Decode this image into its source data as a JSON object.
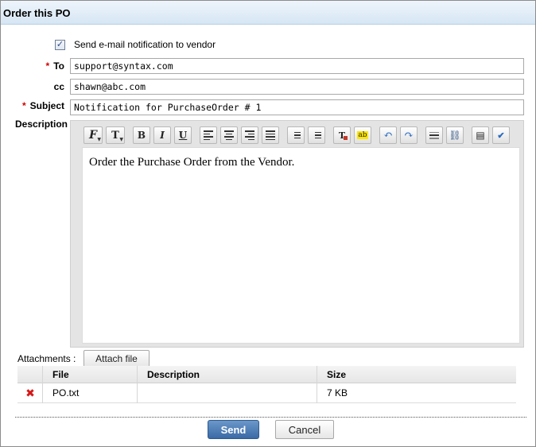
{
  "dialog": {
    "title": "Order this PO"
  },
  "notify": {
    "checked": "✓",
    "label": "Send e-mail notification to vendor"
  },
  "fields": {
    "required_mark": "*",
    "to_label": "To",
    "to_value": "support@syntax.com",
    "cc_label": "cc",
    "cc_value": "shawn@abc.com",
    "subject_label": "Subject",
    "subject_value": "Notification for PurchaseOrder # 1",
    "description_label": "Description"
  },
  "editor": {
    "toolbar": [
      "font-family-icon",
      "font-size-icon",
      "bold-icon",
      "italic-icon",
      "underline-icon",
      "align-left-icon",
      "align-center-icon",
      "align-right-icon",
      "justify-icon",
      "numbered-list-icon",
      "bullet-list-icon",
      "text-color-icon",
      "highlight-icon",
      "undo-icon",
      "redo-icon",
      "horizontal-rule-icon",
      "link-icon",
      "source-icon",
      "spellcheck-icon"
    ],
    "glyphs": {
      "bold": "B",
      "italic": "I",
      "underline": "U",
      "font": "F",
      "size": "T",
      "abc": "ab"
    },
    "body_text": "Order the Purchase Order from the Vendor."
  },
  "attachments": {
    "label": "Attachments :",
    "attach_button": "Attach file",
    "columns": [
      "File",
      "Description",
      "Size"
    ],
    "rows": [
      {
        "file": "PO.txt",
        "description": "",
        "size": "7 KB"
      }
    ]
  },
  "actions": {
    "send": "Send",
    "cancel": "Cancel"
  },
  "colors": {
    "required": "#d40000",
    "send_bg": "#3a6aa6",
    "delete": "#d61818"
  }
}
